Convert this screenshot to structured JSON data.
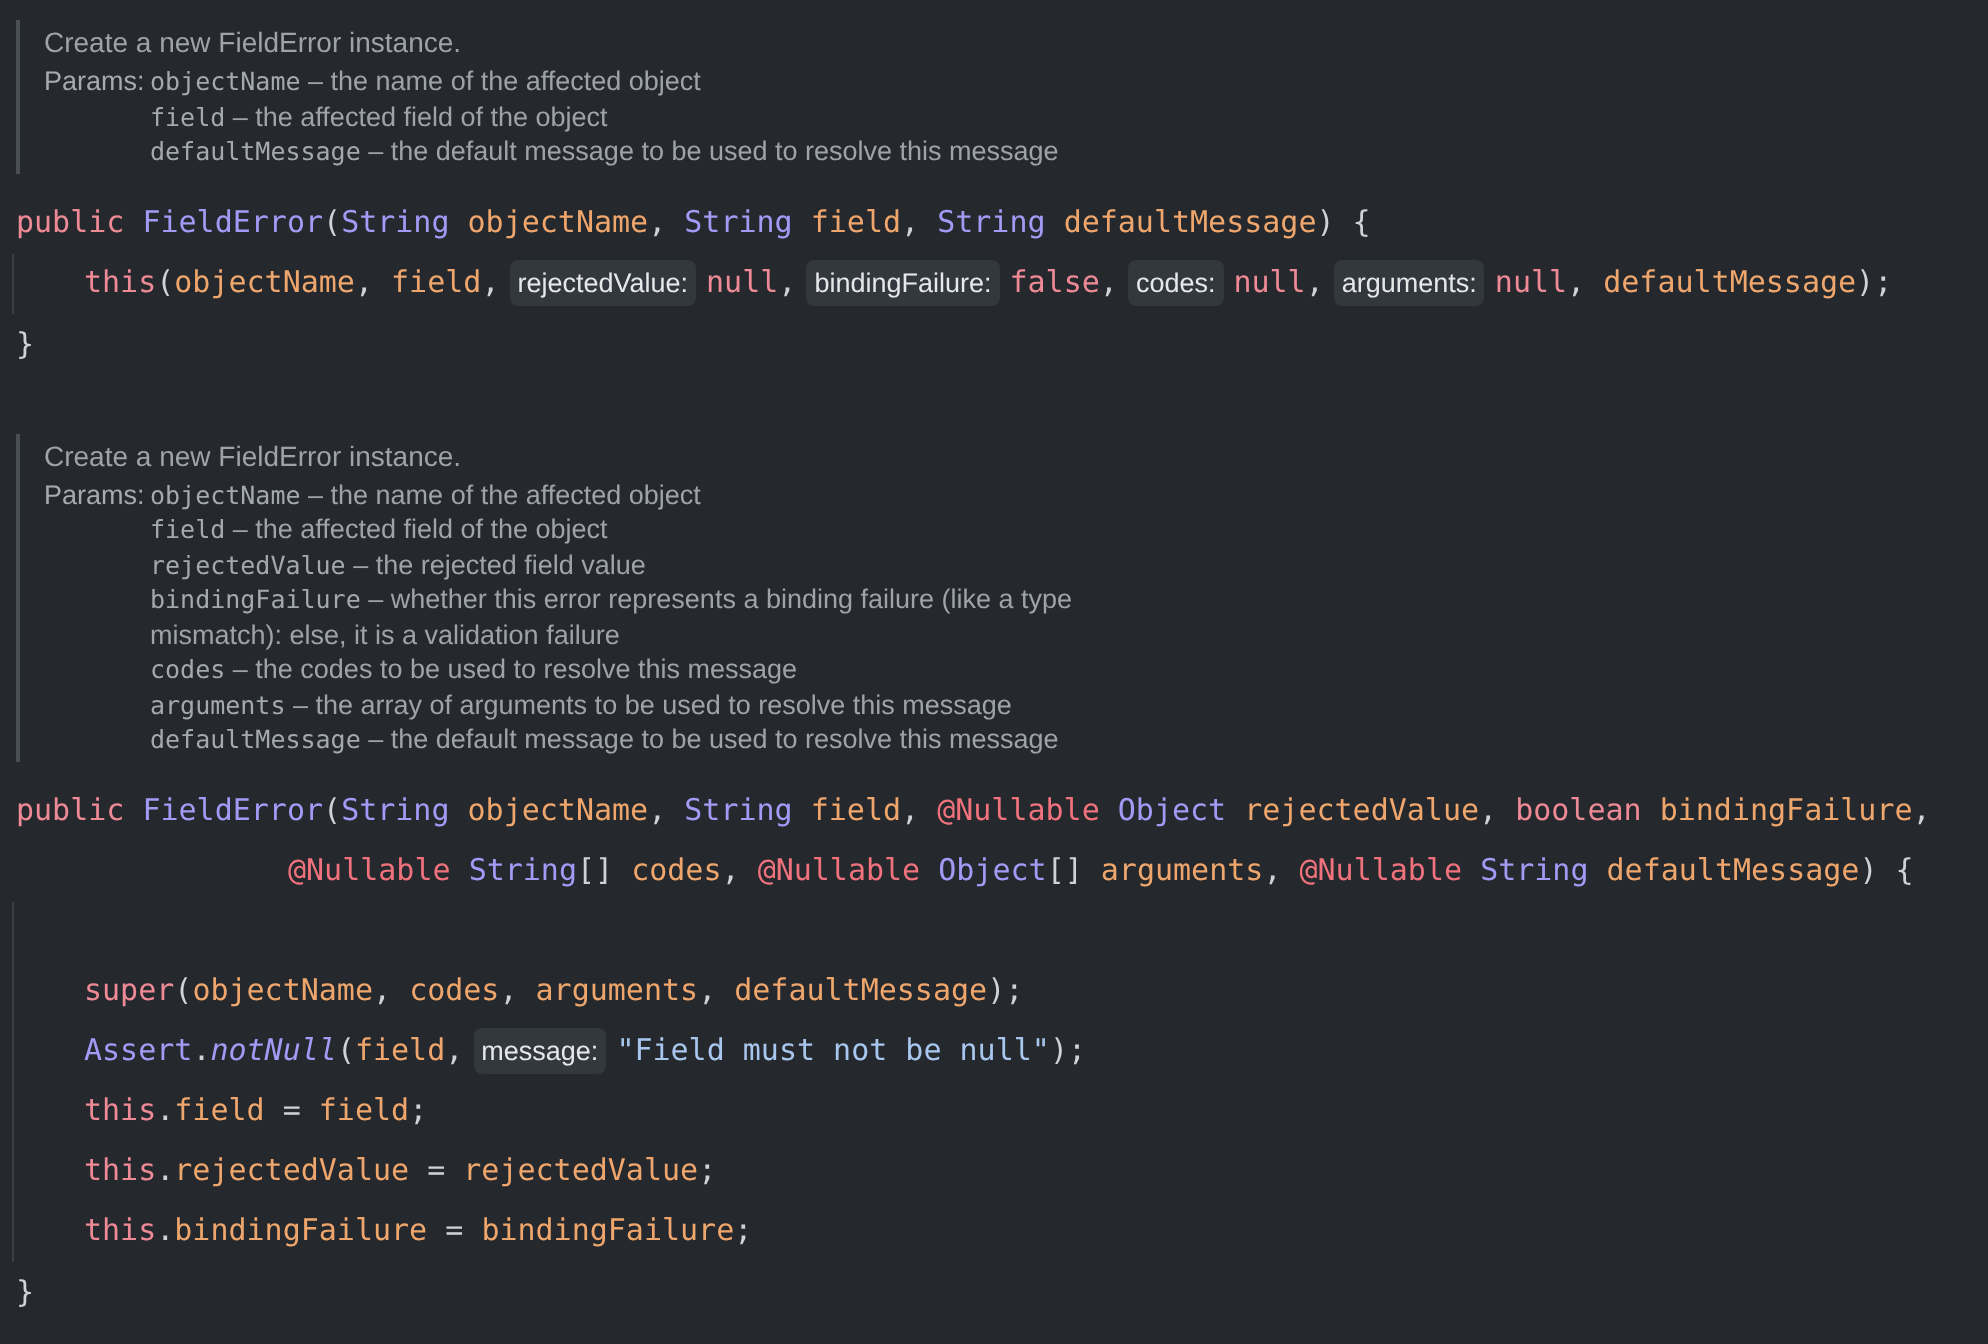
{
  "blocks": [
    {
      "doc": {
        "summary": "Create a new FieldError instance.",
        "params_label": "Params:",
        "params": [
          {
            "name": "objectName",
            "description": "– the name of the affected object"
          },
          {
            "name": "field",
            "description": "– the affected field of the object"
          },
          {
            "name": "defaultMessage",
            "description": "– the default message to be used to resolve this message"
          }
        ]
      },
      "signature": [
        {
          "tokens": [
            {
              "kind": "keyword",
              "text": "public "
            },
            {
              "kind": "type",
              "text": "FieldError"
            },
            {
              "kind": "plain",
              "text": "("
            },
            {
              "kind": "type",
              "text": "String "
            },
            {
              "kind": "param",
              "text": "objectName"
            },
            {
              "kind": "plain",
              "text": ", "
            },
            {
              "kind": "type",
              "text": "String "
            },
            {
              "kind": "param",
              "text": "field"
            },
            {
              "kind": "plain",
              "text": ", "
            },
            {
              "kind": "type",
              "text": "String "
            },
            {
              "kind": "param",
              "text": "defaultMessage"
            },
            {
              "kind": "plain",
              "text": ") {"
            }
          ]
        }
      ],
      "body": [
        {
          "kind": "code",
          "tokens": [
            {
              "kind": "keyword",
              "text": "this"
            },
            {
              "kind": "plain",
              "text": "("
            },
            {
              "kind": "param",
              "text": "objectName"
            },
            {
              "kind": "plain",
              "text": ", "
            },
            {
              "kind": "param",
              "text": "field"
            },
            {
              "kind": "plain",
              "text": ","
            },
            {
              "kind": "hint",
              "text": "rejectedValue:"
            },
            {
              "kind": "keyword",
              "text": "null"
            },
            {
              "kind": "plain",
              "text": ","
            },
            {
              "kind": "hint",
              "text": "bindingFailure:"
            },
            {
              "kind": "keyword",
              "text": "false"
            },
            {
              "kind": "plain",
              "text": ","
            },
            {
              "kind": "hint",
              "text": "codes:"
            },
            {
              "kind": "keyword",
              "text": "null"
            },
            {
              "kind": "plain",
              "text": ","
            },
            {
              "kind": "hint",
              "text": "arguments:"
            },
            {
              "kind": "keyword",
              "text": "null"
            },
            {
              "kind": "plain",
              "text": ", "
            },
            {
              "kind": "param",
              "text": "defaultMessage"
            },
            {
              "kind": "plain",
              "text": ");"
            }
          ]
        }
      ],
      "close": "}"
    },
    {
      "doc": {
        "summary": "Create a new FieldError instance.",
        "params_label": "Params:",
        "params": [
          {
            "name": "objectName",
            "description": "– the name of the affected object"
          },
          {
            "name": "field",
            "description": "– the affected field of the object"
          },
          {
            "name": "rejectedValue",
            "description": "– the rejected field value"
          },
          {
            "name": "bindingFailure",
            "description": "– whether this error represents a binding failure (like a type mismatch): else, it is a validation failure"
          },
          {
            "name": "codes",
            "description": "– the codes to be used to resolve this message"
          },
          {
            "name": "arguments",
            "description": "– the array of arguments to be used to resolve this message"
          },
          {
            "name": "defaultMessage",
            "description": "– the default message to be used to resolve this message"
          }
        ]
      },
      "signature": [
        {
          "tokens": [
            {
              "kind": "keyword",
              "text": "public "
            },
            {
              "kind": "type",
              "text": "FieldError"
            },
            {
              "kind": "plain",
              "text": "("
            },
            {
              "kind": "type",
              "text": "String "
            },
            {
              "kind": "param",
              "text": "objectName"
            },
            {
              "kind": "plain",
              "text": ", "
            },
            {
              "kind": "type",
              "text": "String "
            },
            {
              "kind": "param",
              "text": "field"
            },
            {
              "kind": "plain",
              "text": ", "
            },
            {
              "kind": "annotation",
              "text": "@Nullable "
            },
            {
              "kind": "type",
              "text": "Object "
            },
            {
              "kind": "param",
              "text": "rejectedValue"
            },
            {
              "kind": "plain",
              "text": ", "
            },
            {
              "kind": "keyword",
              "text": "boolean "
            },
            {
              "kind": "param",
              "text": "bindingFailure"
            },
            {
              "kind": "plain",
              "text": ","
            }
          ]
        },
        {
          "tokens": [
            {
              "kind": "annotation",
              "text": "@Nullable "
            },
            {
              "kind": "type",
              "text": "String"
            },
            {
              "kind": "plain",
              "text": "[] "
            },
            {
              "kind": "param",
              "text": "codes"
            },
            {
              "kind": "plain",
              "text": ", "
            },
            {
              "kind": "annotation",
              "text": "@Nullable "
            },
            {
              "kind": "type",
              "text": "Object"
            },
            {
              "kind": "plain",
              "text": "[] "
            },
            {
              "kind": "param",
              "text": "arguments"
            },
            {
              "kind": "plain",
              "text": ", "
            },
            {
              "kind": "annotation",
              "text": "@Nullable "
            },
            {
              "kind": "type",
              "text": "String "
            },
            {
              "kind": "param",
              "text": "defaultMessage"
            },
            {
              "kind": "plain",
              "text": ") {"
            }
          ]
        }
      ],
      "body": [
        {
          "kind": "blank"
        },
        {
          "kind": "code",
          "tokens": [
            {
              "kind": "keyword",
              "text": "super"
            },
            {
              "kind": "plain",
              "text": "("
            },
            {
              "kind": "param",
              "text": "objectName"
            },
            {
              "kind": "plain",
              "text": ", "
            },
            {
              "kind": "param",
              "text": "codes"
            },
            {
              "kind": "plain",
              "text": ", "
            },
            {
              "kind": "param",
              "text": "arguments"
            },
            {
              "kind": "plain",
              "text": ", "
            },
            {
              "kind": "param",
              "text": "defaultMessage"
            },
            {
              "kind": "plain",
              "text": ");"
            }
          ]
        },
        {
          "kind": "code",
          "tokens": [
            {
              "kind": "type",
              "text": "Assert"
            },
            {
              "kind": "plain",
              "text": "."
            },
            {
              "kind": "method",
              "text": "notNull"
            },
            {
              "kind": "plain",
              "text": "("
            },
            {
              "kind": "param",
              "text": "field"
            },
            {
              "kind": "plain",
              "text": ","
            },
            {
              "kind": "hint",
              "text": "message:"
            },
            {
              "kind": "string",
              "text": "\"Field must not be null\""
            },
            {
              "kind": "plain",
              "text": ");"
            }
          ]
        },
        {
          "kind": "code",
          "tokens": [
            {
              "kind": "keyword",
              "text": "this"
            },
            {
              "kind": "plain",
              "text": "."
            },
            {
              "kind": "param",
              "text": "field"
            },
            {
              "kind": "plain",
              "text": " = "
            },
            {
              "kind": "param",
              "text": "field"
            },
            {
              "kind": "plain",
              "text": ";"
            }
          ]
        },
        {
          "kind": "code",
          "tokens": [
            {
              "kind": "keyword",
              "text": "this"
            },
            {
              "kind": "plain",
              "text": "."
            },
            {
              "kind": "param",
              "text": "rejectedValue"
            },
            {
              "kind": "plain",
              "text": " = "
            },
            {
              "kind": "param",
              "text": "rejectedValue"
            },
            {
              "kind": "plain",
              "text": ";"
            }
          ]
        },
        {
          "kind": "code",
          "tokens": [
            {
              "kind": "keyword",
              "text": "this"
            },
            {
              "kind": "plain",
              "text": "."
            },
            {
              "kind": "param",
              "text": "bindingFailure"
            },
            {
              "kind": "plain",
              "text": " = "
            },
            {
              "kind": "param",
              "text": "bindingFailure"
            },
            {
              "kind": "plain",
              "text": ";"
            }
          ]
        }
      ],
      "close": "}"
    }
  ]
}
